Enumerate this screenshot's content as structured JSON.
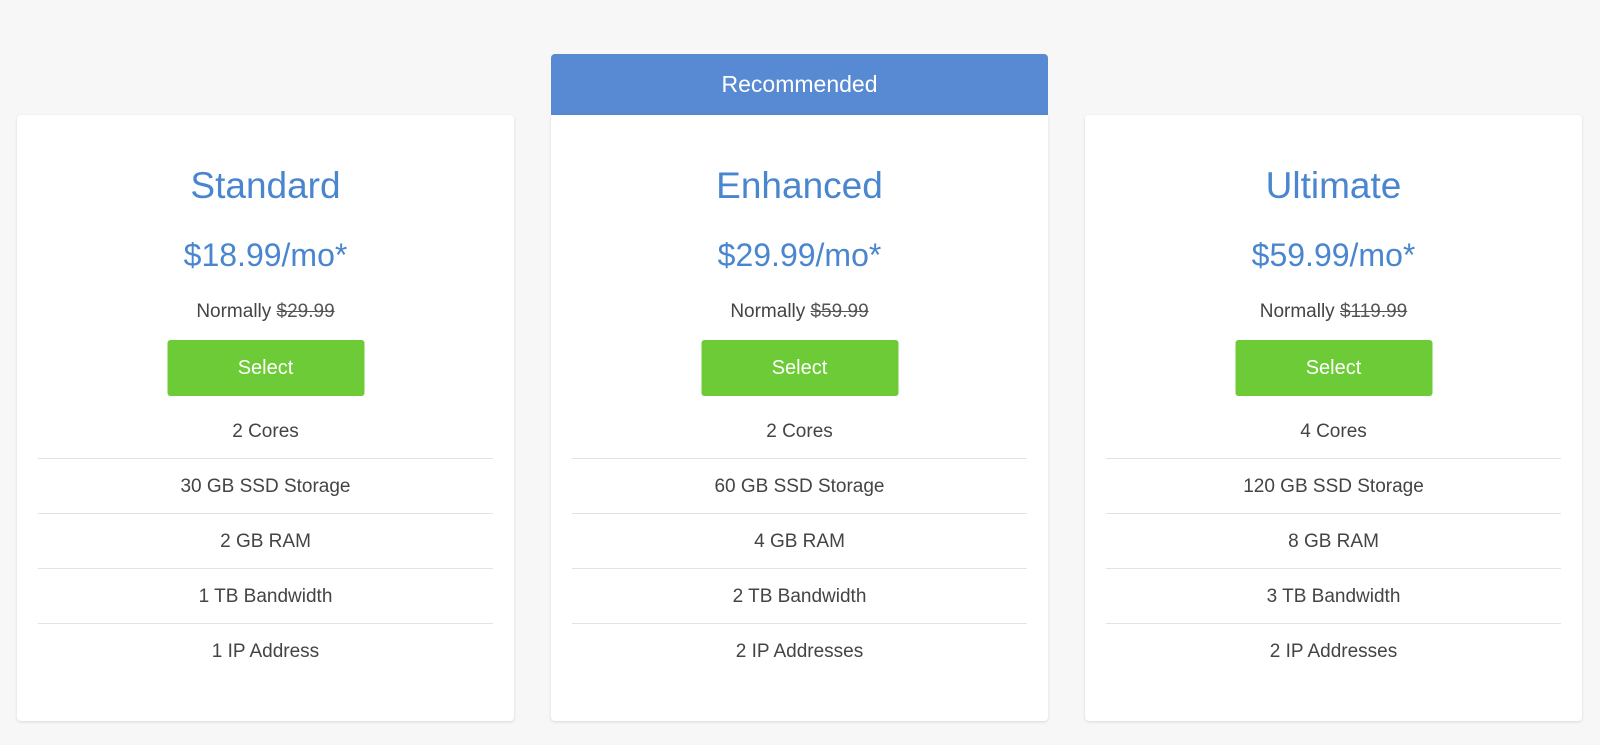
{
  "ribbon_label": "Recommended",
  "colors": {
    "accent": "#4a86cf",
    "ribbon": "#578ad2",
    "select_button": "#6ccb36",
    "background": "#f7f7f7"
  },
  "plans": [
    {
      "name": "Standard",
      "price": "$18.99/mo*",
      "normally_label": "Normally",
      "normal_price": "$29.99",
      "select_label": "Select",
      "features": [
        "2 Cores",
        "30 GB SSD Storage",
        "2 GB RAM",
        "1 TB Bandwidth",
        "1 IP Address"
      ]
    },
    {
      "name": "Enhanced",
      "price": "$29.99/mo*",
      "normally_label": "Normally",
      "normal_price": "$59.99",
      "select_label": "Select",
      "recommended": true,
      "features": [
        "2 Cores",
        "60 GB SSD Storage",
        "4 GB RAM",
        "2 TB Bandwidth",
        "2 IP Addresses"
      ]
    },
    {
      "name": "Ultimate",
      "price": "$59.99/mo*",
      "normally_label": "Normally",
      "normal_price": "$119.99",
      "select_label": "Select",
      "features": [
        "4 Cores",
        "120 GB SSD Storage",
        "8 GB RAM",
        "3 TB Bandwidth",
        "2 IP Addresses"
      ]
    }
  ]
}
